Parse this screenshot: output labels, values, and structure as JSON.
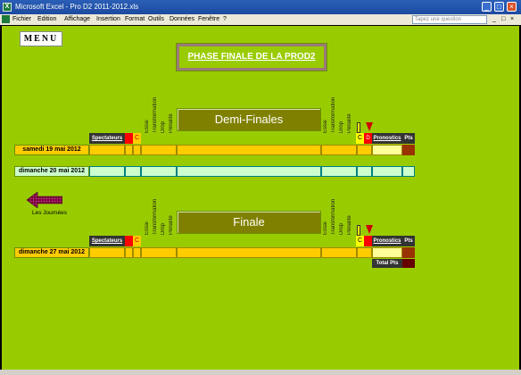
{
  "window": {
    "title": "Microsoft Excel - Pro D2  2011-2012.xls"
  },
  "menubar": {
    "items": [
      "Fichier",
      "Edition",
      "Affichage",
      "Insertion",
      "Format",
      "Outils",
      "Données",
      "Fenêtre",
      "?"
    ],
    "help_placeholder": "Tapez une question"
  },
  "sheet": {
    "menu_button": "MENU",
    "phase_title": "PHASE FINALE DE LA PROD2",
    "nav_label": "Les Journées",
    "columns": [
      "Essai",
      "Transformation",
      "Drop",
      "Pénalité"
    ],
    "markers": {
      "c": "C",
      "d": "D"
    },
    "spectateurs": "Spectateurs",
    "pronostics": "Pronostics",
    "pts": "Pts",
    "total_pts": "Total Pts",
    "semis": {
      "banner": "Demi-Finales",
      "date1": "samedi 19 mai 2012",
      "date2": "dimanche 20 mai 2012"
    },
    "final": {
      "banner": "Finale",
      "date1": "dimanche 27 mai 2012"
    }
  },
  "colors": {
    "sheet_bg": "#99cc00",
    "banner": "#808000",
    "orange": "#ffcc00",
    "mint": "#ccffcc",
    "red": "#ff0000",
    "yellow": "#ffff00",
    "dark": "#333333",
    "brown": "#993300"
  }
}
